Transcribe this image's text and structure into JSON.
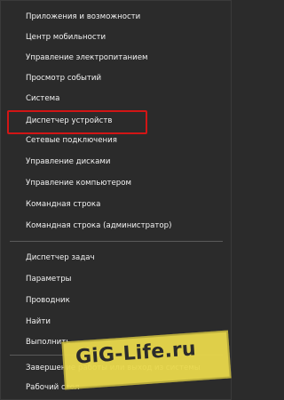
{
  "menu": {
    "group1": [
      "Приложения и возможности",
      "Центр мобильности",
      "Управление электропитанием",
      "Просмотр событий",
      "Система",
      "Диспетчер устройств",
      "Сетевые подключения",
      "Управление дисками",
      "Управление компьютером",
      "Командная строка",
      "Командная строка (администратор)"
    ],
    "group2": [
      "Диспетчер задач",
      "Параметры",
      "Проводник",
      "Найти",
      "Выполнить"
    ],
    "group3": [
      "Завершение работы или выход из системы",
      "Рабочий стол"
    ],
    "highlighted_item": "Диспетчер устройств"
  },
  "watermark": {
    "text": "GiG-Life.ru"
  },
  "colors": {
    "background": "#2b2b2b",
    "text": "#f2f2f2",
    "highlight_border": "#d21515",
    "watermark_bg": "#e9d84b"
  }
}
